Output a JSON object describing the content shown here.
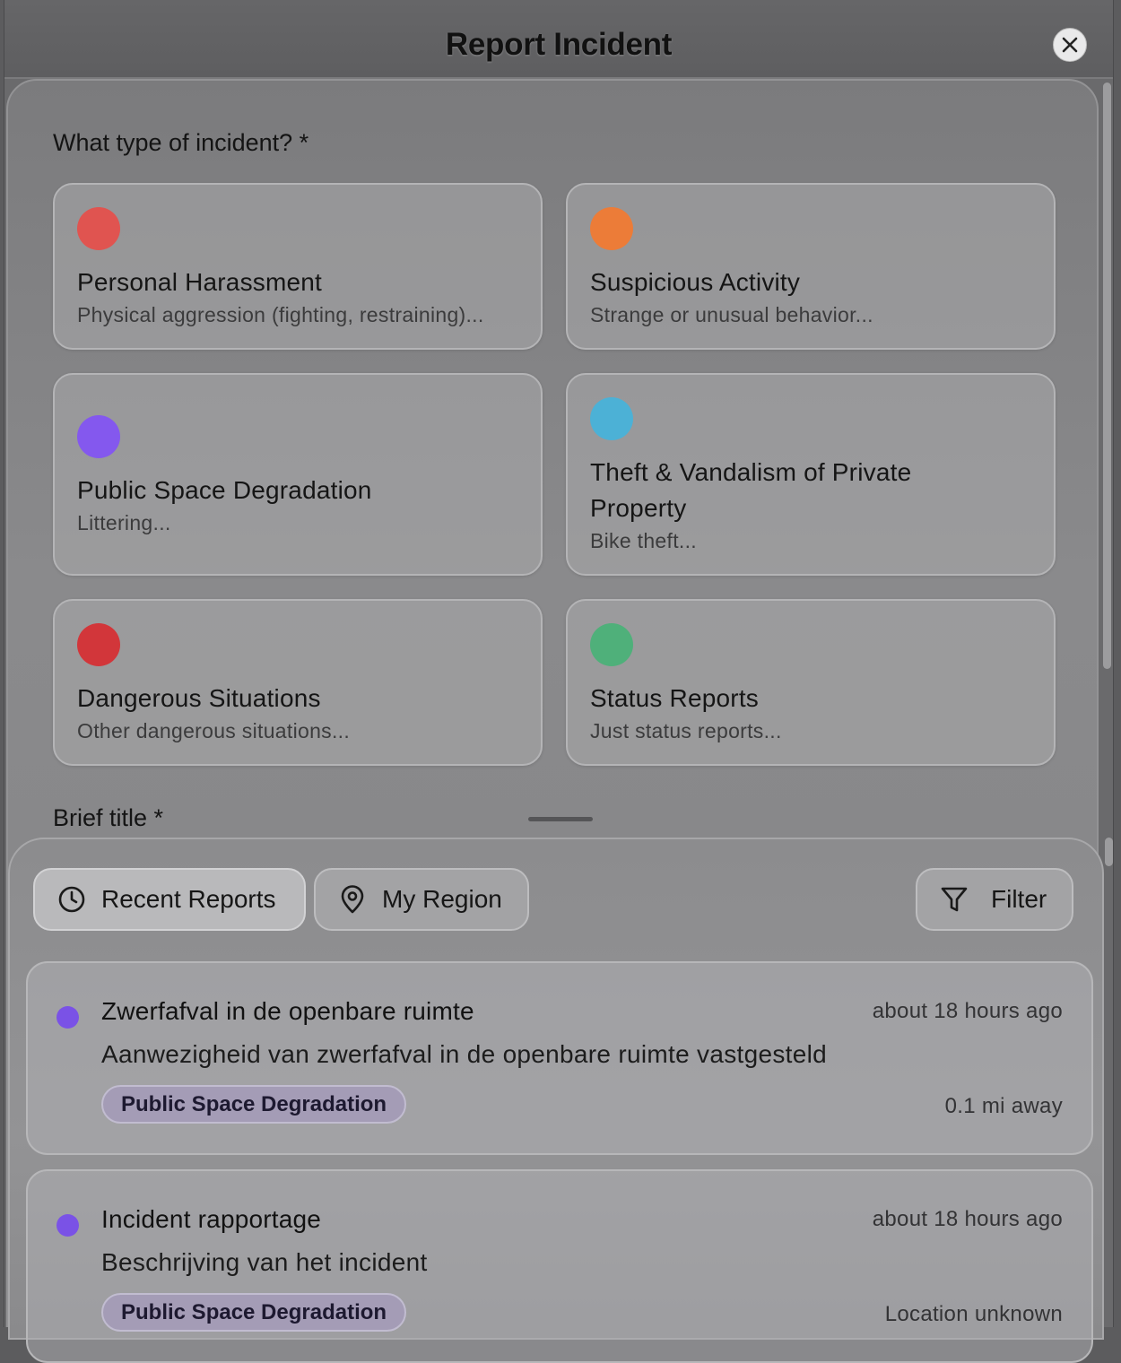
{
  "header": {
    "title": "Report Incident"
  },
  "form": {
    "type_label": "What type of incident? *",
    "title_label": "Brief title *",
    "incident_types": [
      {
        "title": "Personal Harassment",
        "description": "Physical aggression (fighting, restraining)...",
        "color": "#e05450"
      },
      {
        "title": "Suspicious Activity",
        "description": "Strange or unusual behavior...",
        "color": "#ec7c38"
      },
      {
        "title": "Public Space Degradation",
        "description": "Littering...",
        "color": "#8458ee"
      },
      {
        "title": "Theft & Vandalism of Private Property",
        "description": "Bike theft...",
        "color": "#4cb1d6"
      },
      {
        "title": "Dangerous Situations",
        "description": "Other dangerous situations...",
        "color": "#d2363a"
      },
      {
        "title": "Status Reports",
        "description": "Just status reports...",
        "color": "#4fb07a"
      }
    ]
  },
  "sheet": {
    "tabs": [
      {
        "label": "Recent Reports",
        "icon": "clock-icon",
        "active": true
      },
      {
        "label": "My Region",
        "icon": "map-pin-icon",
        "active": false
      }
    ],
    "filter_label": "Filter",
    "reports": [
      {
        "title": "Zwerfafval in de openbare ruimte",
        "time": "about 18 hours ago",
        "description": "Aanwezigheid van zwerfafval in de openbare ruimte vastgesteld",
        "category": "Public Space Degradation",
        "distance": "0.1 mi away"
      },
      {
        "title": "Incident rapportage",
        "time": "about 18 hours ago",
        "description": "Beschrijving van het incident",
        "category": "Public Space Degradation",
        "distance": "Location unknown"
      }
    ]
  },
  "colors": {
    "category_dot": "#7a52e6"
  }
}
